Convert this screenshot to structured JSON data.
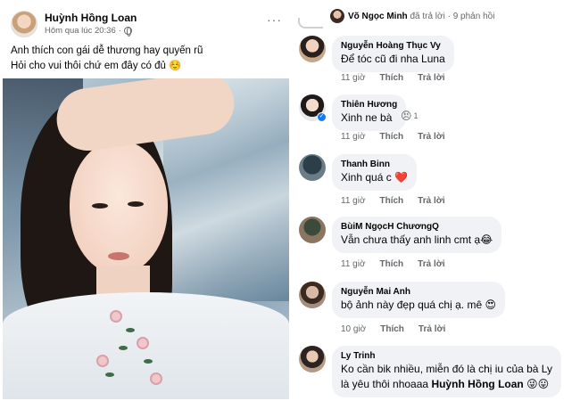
{
  "post": {
    "author": "Huỳnh Hồng Loan",
    "time": "Hôm qua lúc 20:36",
    "privacy_icon": "globe-icon",
    "more_icon": "more-icon",
    "text_lines": [
      "Anh thích con gái dễ thương hay quyến rũ",
      "Hỏi cho vui thôi chứ em đây có đủ ☺️"
    ]
  },
  "thread": {
    "replier": "Võ Ngọc Minh",
    "replied_text": "đã trả lời",
    "reply_count": "9 phản hồi"
  },
  "comments": [
    {
      "name": "Nguyễn Hoàng Thục Vy",
      "text": "Để tóc cũ đi nha Luna",
      "time": "11 giờ",
      "like": "Thích",
      "reply": "Trả lời"
    },
    {
      "name": "Thiên Hương",
      "text": "Xinh ne bà",
      "time": "11 giờ",
      "like": "Thích",
      "reply": "Trả lời",
      "reaction_emoji": "😣",
      "reaction_count": "1",
      "verified": true
    },
    {
      "name": "Thanh Binn",
      "text": "Xinh quá c ❤️",
      "time": "11 giờ",
      "like": "Thích",
      "reply": "Trả lời"
    },
    {
      "name": "BùiM NgọcH ChươngQ",
      "text": "Vẫn chưa thấy anh linh cmt ạ😂",
      "time": "11 giờ",
      "like": "Thích",
      "reply": "Trả lời"
    },
    {
      "name": "Nguyễn Mai Anh",
      "text": "bộ ảnh này đẹp quá chị ạ. mê 😍",
      "time": "10 giờ",
      "like": "Thích",
      "reply": "Trả lời"
    },
    {
      "name": "Ly Trinh",
      "text_line1": "Ko cần bik nhiều, miễn đó là chị iu của bà Ly",
      "text_line2_prefix": "là yêu thôi nhoaaa",
      "mention": "Huỳnh Hồng Loan",
      "text_line2_suffix": "😜😛"
    }
  ],
  "colors": {
    "bubble_bg": "#f0f2f5",
    "secondary_text": "#65676b",
    "verified": "#1877f2"
  }
}
